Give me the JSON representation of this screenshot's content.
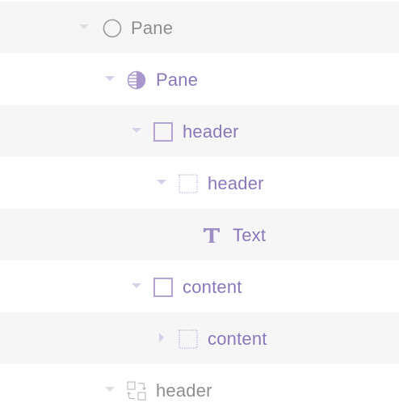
{
  "layer_tree": {
    "nodes": [
      {
        "label": "Pane",
        "icon": "circle-outline-icon",
        "expand_state": "expanded",
        "color": "#8e8e8e"
      },
      {
        "label": "Pane",
        "icon": "half-filled-circle-icon",
        "expand_state": "expanded",
        "color": "#8b78b9"
      },
      {
        "label": "header",
        "icon": "square-outline-icon",
        "expand_state": "expanded",
        "color": "#8b78b9"
      },
      {
        "label": "header",
        "icon": "dotted-square-icon",
        "expand_state": "expanded",
        "color": "#8b78b9"
      },
      {
        "label": "Text",
        "icon": "text-t-icon",
        "expand_state": "none",
        "color": "#8b78b9"
      },
      {
        "label": "content",
        "icon": "square-outline-icon",
        "expand_state": "expanded",
        "color": "#8b78b9"
      },
      {
        "label": "content",
        "icon": "dotted-square-icon",
        "expand_state": "collapsed",
        "color": "#8b78b9"
      },
      {
        "label": "header",
        "icon": "component-instance-icon",
        "expand_state": "expanded",
        "color": "#8e8e8e"
      }
    ]
  },
  "colors": {
    "accent_purple": "#8b78b9",
    "icon_purple": "#b7a8d6",
    "muted_grey": "#8e8e8e",
    "stripe": "#f6f6f6"
  }
}
